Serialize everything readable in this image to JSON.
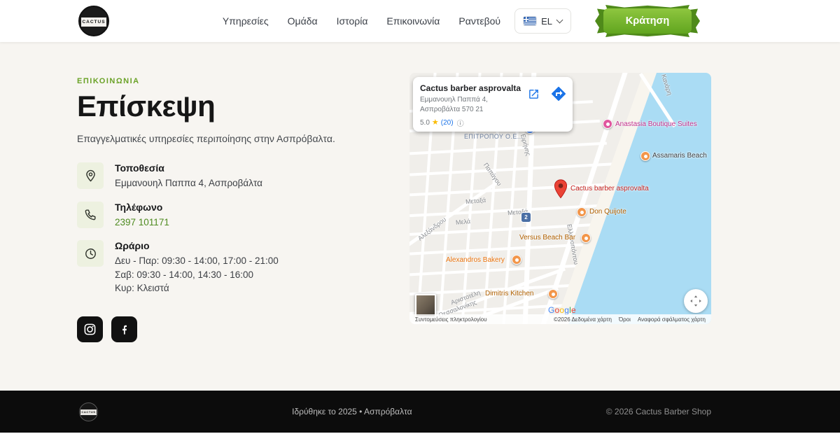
{
  "brand": {
    "logo_text": "CACTUS"
  },
  "header": {
    "nav": [
      {
        "label": "Υπηρεσίες"
      },
      {
        "label": "Ομάδα"
      },
      {
        "label": "Ιστορία"
      },
      {
        "label": "Επικοινωνία"
      },
      {
        "label": "Ραντεβού"
      }
    ],
    "lang": {
      "label": "EL"
    },
    "cta_label": "Κράτηση"
  },
  "contact": {
    "overline": "ΕΠΙΚΟΙΝΩΝΙΑ",
    "title": "Επίσκεψη",
    "intro": "Επαγγελματικές υπηρεσίες περιποίησης στην Ασπρόβαλτα.",
    "location": {
      "title": "Τοποθεσία",
      "value": "Εμμανουηλ Παππα 4, Ασπροβάλτα"
    },
    "phone": {
      "title": "Τηλέφωνο",
      "value": "2397 101171"
    },
    "hours": {
      "title": "Ωράριο",
      "line1": "Δευ - Παρ: 09:30 - 14:00, 17:00 - 21:00",
      "line2": "Σαβ: 09:30 - 14:00, 14:30 - 16:00",
      "line3": "Κυρ: Κλειστά"
    }
  },
  "map": {
    "card": {
      "title": "Cactus barber asprovalta",
      "address_line1": "Εμμανουηλ Παππά 4,",
      "address_line2": "Ασπροβάλτα 570 21",
      "rating": "5.0",
      "reviews": "(20)"
    },
    "pois": {
      "anastasia": "Anastasia Boutique Suites",
      "assamaris": "Assamaris Beach",
      "cactus": "Cactus barber asprovalta",
      "don_quijote": "Don Quijote",
      "versus": "Versus Beach Bar",
      "alexandros": "Alexandros Bakery",
      "dimitris": "Dimitris Kitchen",
      "epitropou": "ΕΠΙΤΡΟΠΟΥ Ο.Ε..."
    },
    "streets": {
      "eirinis": "Ειρήνης",
      "papagou": "Παπάγου",
      "metaxa": "Μεταξά",
      "metaxa2": "Μεταξά",
      "mela": "Μελά",
      "alexandrou": "Αλεξάνδρου",
      "ellinopontou": "Ελληνοπόντου",
      "kanari": "Κανάρη",
      "aristoteli": "Αριστοτέλη",
      "thessalonikis": "Θεσσαλονίκης"
    },
    "road_badge": "2",
    "google_letters": [
      "G",
      "o",
      "o",
      "g",
      "l",
      "e"
    ],
    "attribution": {
      "shortcuts": "Συντομεύσεις πληκτρολογίου",
      "data": "©2026 Δεδομένα χάρτη",
      "terms": "Όροι",
      "report": "Αναφορά σφάλματος χάρτη"
    }
  },
  "footer": {
    "founded": "Ιδρύθηκε το 2025 • Ασπρόβαλτα",
    "copyright": "© 2026 Cactus Barber Shop"
  },
  "colors": {
    "accent_green": "#61a51f",
    "footer_bg": "#0c0c0c",
    "water": "#aadcf4"
  }
}
